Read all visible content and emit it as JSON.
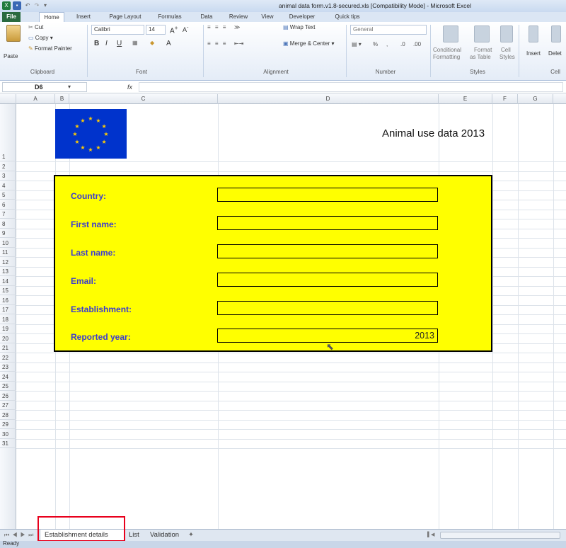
{
  "title_bar": {
    "title": "animal data form.v1.8-secured.xls [Compatibility Mode] - Microsoft Excel"
  },
  "ribbon_tabs": [
    "File",
    "Home",
    "Insert",
    "Page Layout",
    "Formulas",
    "Data",
    "Review",
    "View",
    "Developer",
    "Quick tips"
  ],
  "ribbon": {
    "clipboard": {
      "paste": "Paste",
      "cut": "Cut",
      "copy": "Copy",
      "format_painter": "Format Painter",
      "label": "Clipboard"
    },
    "font": {
      "name": "Calibri",
      "size": "14",
      "label": "Font"
    },
    "alignment": {
      "wrap_text": "Wrap Text",
      "merge_center": "Merge & Center",
      "label": "Alignment"
    },
    "number": {
      "format": "General",
      "label": "Number"
    },
    "styles": {
      "conditional": "Conditional",
      "conditional2": "Formatting",
      "format_table": "Format",
      "format_table2": "as Table",
      "cell_styles": "Cell",
      "cell_styles2": "Styles",
      "label": "Styles"
    },
    "cells": {
      "insert": "Insert",
      "delete": "Delet",
      "label": "Cell"
    }
  },
  "formula_bar": {
    "name_box": "D6",
    "fx": "fx",
    "value": ""
  },
  "columns": [
    "A",
    "B",
    "C",
    "D",
    "E",
    "F",
    "G"
  ],
  "rows": [
    "1",
    "2",
    "3",
    "4",
    "5",
    "6",
    "7",
    "8",
    "9",
    "10",
    "11",
    "12",
    "13",
    "14",
    "15",
    "16",
    "17",
    "18",
    "19",
    "20",
    "21",
    "22",
    "23",
    "24",
    "25",
    "26",
    "27",
    "28",
    "29",
    "30",
    "31"
  ],
  "sheet": {
    "heading": "Animal use data 2013",
    "form": [
      {
        "label": "Country:",
        "value": ""
      },
      {
        "label": "First name:",
        "value": ""
      },
      {
        "label": "Last name:",
        "value": ""
      },
      {
        "label": "Email:",
        "value": ""
      },
      {
        "label": "Establishment:",
        "value": ""
      },
      {
        "label": "Reported year:",
        "value": "2013"
      }
    ]
  },
  "sheet_tabs": [
    "Establishment details",
    "List",
    "Validation"
  ],
  "status": {
    "text": "Ready"
  },
  "colors": {
    "form_bg": "#ffff00",
    "label": "#3b3bd0",
    "eu_blue": "#0033cc",
    "eu_star": "#ffcc00",
    "highlight": "#e8001c"
  }
}
